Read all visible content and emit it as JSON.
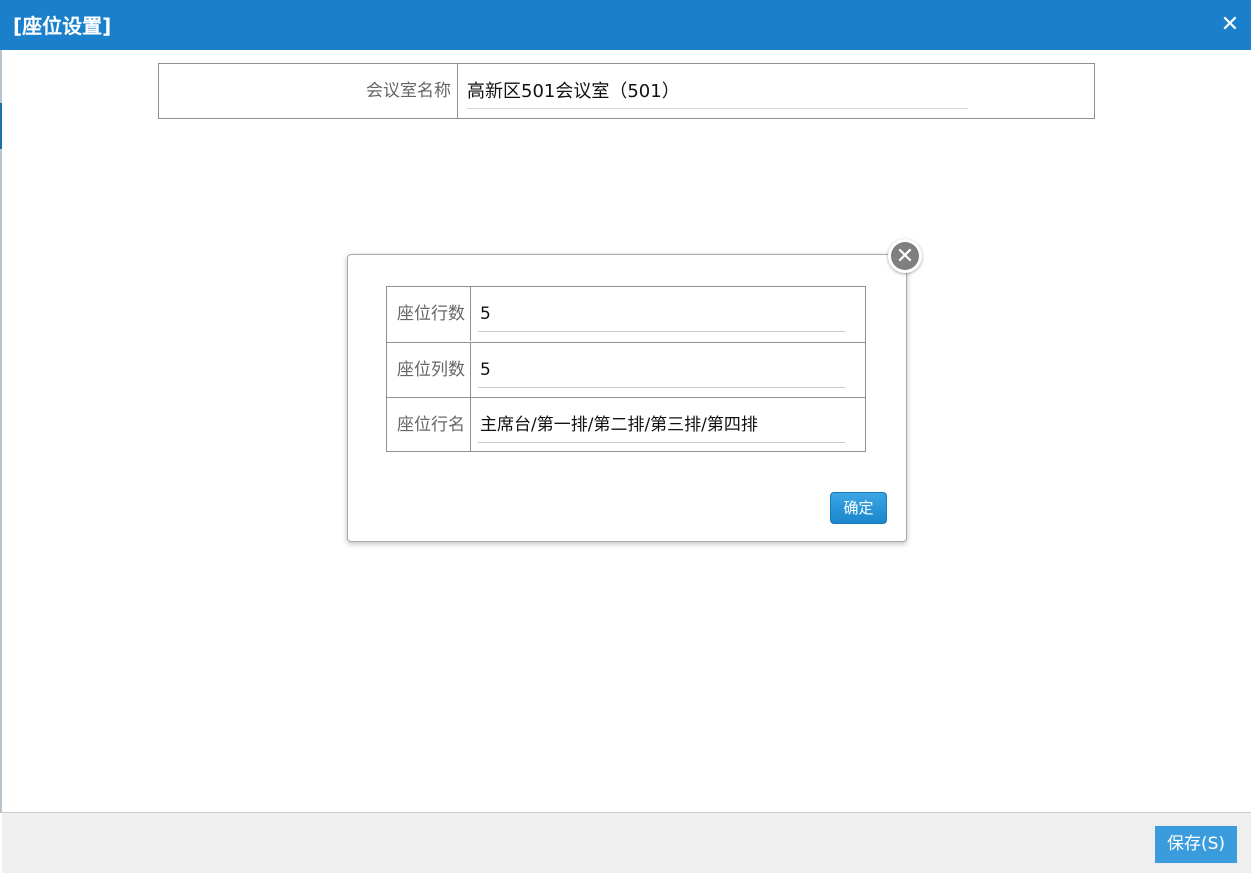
{
  "window": {
    "title": "[座位设置]",
    "close_icon": "close-icon",
    "accent_color": "#1a80cc"
  },
  "room": {
    "label": "会议室名称",
    "value": "高新区501会议室（501）"
  },
  "seat_dialog": {
    "close_icon": "circle-close-icon",
    "fields": [
      {
        "label": "座位行数",
        "value": "5"
      },
      {
        "label": "座位列数",
        "value": "5"
      },
      {
        "label": "座位行名",
        "value": "主席台/第一排/第二排/第三排/第四排"
      }
    ],
    "confirm_label": "确定"
  },
  "footer": {
    "save_label": "保存(S)"
  }
}
